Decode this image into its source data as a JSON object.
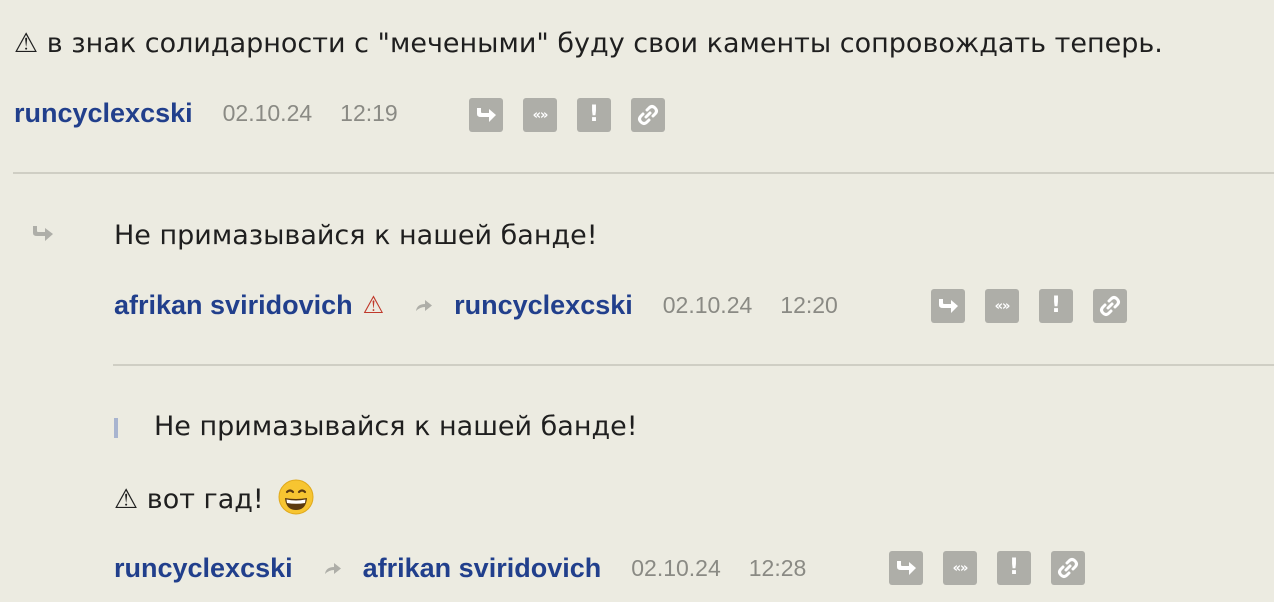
{
  "comment1": {
    "text": "⚠ в знак солидарности с \"мечеными\" буду свои каменты сопровождать теперь.",
    "author": "runcyclexcski",
    "date": "02.10.24",
    "time": "12:19"
  },
  "comment2": {
    "text": "Не примазывайся к нашей банде!",
    "author": "afrikan sviridovich",
    "warning": "⚠",
    "reply_to": "runcyclexcski",
    "date": "02.10.24",
    "time": "12:20"
  },
  "comment3": {
    "quote": "Не примазывайся к нашей банде!",
    "text": "⚠ вот гад!",
    "author": "runcyclexcski",
    "reply_to": "afrikan sviridovich",
    "date": "02.10.24",
    "time": "12:28"
  },
  "actions": {
    "reply_icon": "reply-icon",
    "quote_label": "«»",
    "report_label": "!",
    "link_icon": "link-icon"
  },
  "colors": {
    "background": "#ecebe1",
    "author": "#213f8c",
    "meta": "#8a8a84",
    "icon_bg": "#aeaea8",
    "warning_red": "#c0392b"
  }
}
